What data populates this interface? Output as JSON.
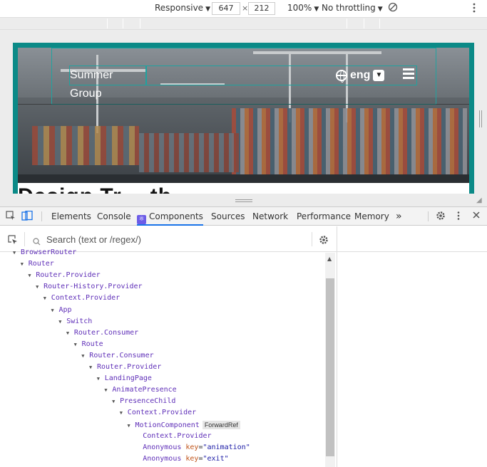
{
  "device_toolbar": {
    "preset": "Responsive",
    "width": "647",
    "times": "×",
    "height": "212",
    "zoom": "100%",
    "throttling": "No throttling"
  },
  "site": {
    "brand": "Summer Group",
    "language": "eng",
    "heading_partial": "Design Tr...th"
  },
  "devtools": {
    "tabs": [
      "Elements",
      "Console",
      "Components",
      "Sources",
      "Network",
      "Performance",
      "Memory"
    ],
    "active_tab": "Components",
    "more": "»",
    "search_placeholder": "Search (text or /regex/)"
  },
  "tree": [
    {
      "label": "BrowserRouter",
      "depth": 0,
      "expanded": true
    },
    {
      "label": "Router",
      "depth": 1,
      "expanded": true
    },
    {
      "label": "Router.Provider",
      "depth": 2,
      "expanded": true
    },
    {
      "label": "Router-History.Provider",
      "depth": 3,
      "expanded": true
    },
    {
      "label": "Context.Provider",
      "depth": 4,
      "expanded": true
    },
    {
      "label": "App",
      "depth": 5,
      "expanded": true
    },
    {
      "label": "Switch",
      "depth": 6,
      "expanded": true
    },
    {
      "label": "Router.Consumer",
      "depth": 7,
      "expanded": true
    },
    {
      "label": "Route",
      "depth": 8,
      "expanded": true
    },
    {
      "label": "Router.Consumer",
      "depth": 9,
      "expanded": true
    },
    {
      "label": "Router.Provider",
      "depth": 10,
      "expanded": true
    },
    {
      "label": "LandingPage",
      "depth": 11,
      "expanded": true
    },
    {
      "label": "AnimatePresence",
      "depth": 12,
      "expanded": true
    },
    {
      "label": "PresenceChild",
      "depth": 13,
      "expanded": true
    },
    {
      "label": "Context.Provider",
      "depth": 14,
      "expanded": true
    },
    {
      "label": "MotionComponent",
      "depth": 15,
      "expanded": true,
      "badge": "ForwardRef"
    },
    {
      "label": "Context.Provider",
      "depth": 16,
      "expanded": false
    },
    {
      "label": "Anonymous",
      "depth": 16,
      "expanded": false,
      "key": "animation"
    },
    {
      "label": "Anonymous",
      "depth": 16,
      "expanded": false,
      "key": "exit"
    }
  ],
  "colors": {
    "teal_frame": "#0b8a87",
    "component_name": "#5f2fb8",
    "active_tab_underline": "#1a73e8"
  }
}
